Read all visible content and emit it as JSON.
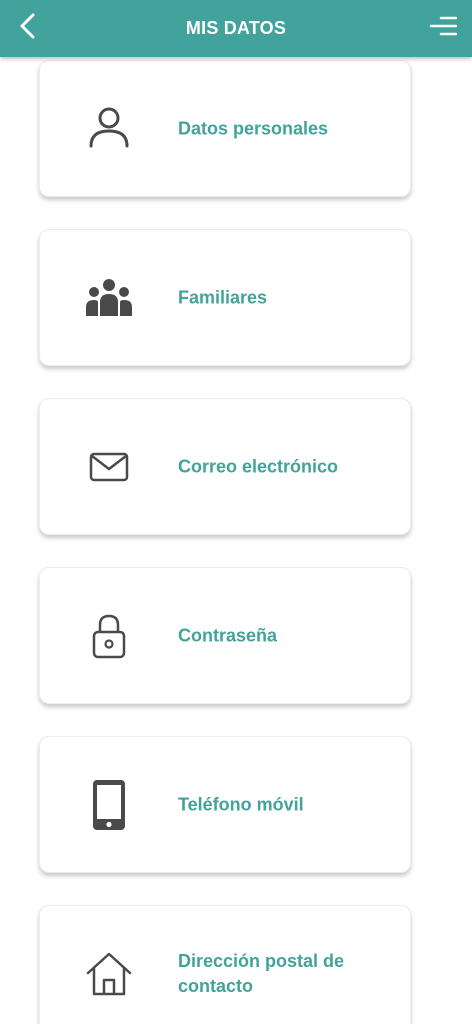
{
  "header": {
    "title": "MIS DATOS",
    "back_icon": "chevron-left-icon",
    "menu_icon": "hamburger-menu-icon",
    "background": "#41a39b"
  },
  "items": [
    {
      "label": "Datos personales",
      "icon": "person-icon"
    },
    {
      "label": "Familiares",
      "icon": "family-icon"
    },
    {
      "label": "Correo electrónico",
      "icon": "envelope-icon"
    },
    {
      "label": "Contraseña",
      "icon": "lock-icon"
    },
    {
      "label": "Teléfono móvil",
      "icon": "mobile-phone-icon"
    },
    {
      "label": "Dirección postal de contacto",
      "icon": "house-icon"
    }
  ],
  "colors": {
    "accent": "#41a39b",
    "icon": "#4a4a4a"
  }
}
